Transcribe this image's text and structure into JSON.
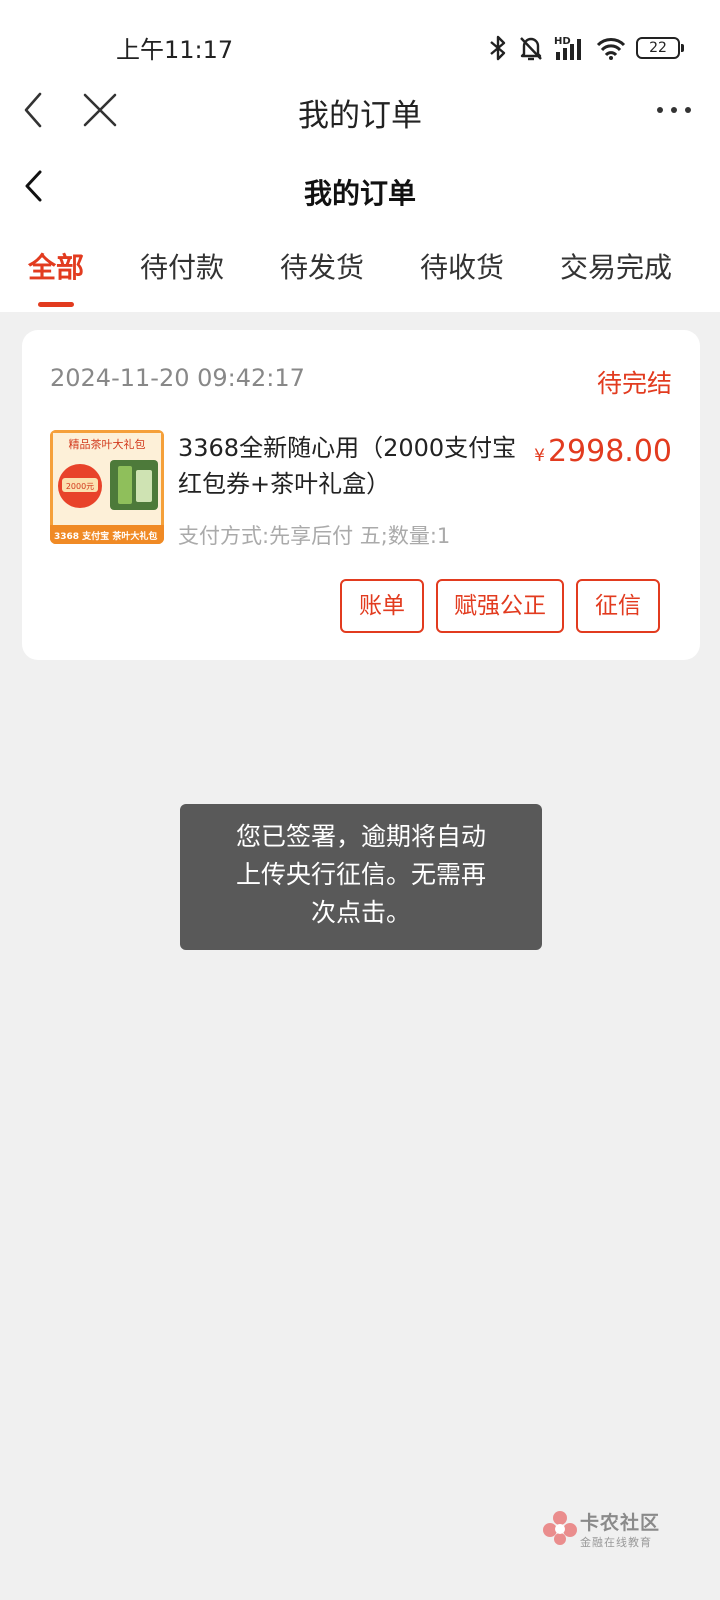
{
  "status_bar": {
    "time": "上午11:17",
    "icons": [
      "bluetooth-icon",
      "bell-muted-icon",
      "hd-signal-icon",
      "wifi-icon",
      "battery-icon"
    ],
    "battery_level": "22"
  },
  "browser_bar": {
    "title": "我的订单",
    "icons": [
      "back-icon",
      "close-icon",
      "more-icon"
    ]
  },
  "page_header": {
    "title": "我的订单"
  },
  "tabs": [
    {
      "label": "全部",
      "active": true
    },
    {
      "label": "待付款",
      "active": false
    },
    {
      "label": "待发货",
      "active": false
    },
    {
      "label": "待收货",
      "active": false
    },
    {
      "label": "交易完成",
      "active": false
    }
  ],
  "order": {
    "datetime": "2024-11-20 09:42:17",
    "status": "待完结",
    "title": "3368全新随心用（2000支付宝红包券+茶叶礼盒）",
    "currency": "¥",
    "price": "2998.00",
    "meta": "支付方式:先享后付 五;数量:1",
    "thumbnail": {
      "top_text": "精品茶叶大礼包",
      "badge": "2000元",
      "bottom_text": "3368 支付宝 茶叶大礼包"
    },
    "buttons": [
      "账单",
      "赋强公正",
      "征信"
    ]
  },
  "toast": {
    "message": "您已签署，逾期将自动上传央行征信。无需再次点击。"
  },
  "watermark": {
    "name": "卡农社区",
    "sub": "金融在线教育"
  },
  "colors": {
    "accent": "#e23b1f",
    "background": "#f0f0f0",
    "toast": "#595959"
  }
}
